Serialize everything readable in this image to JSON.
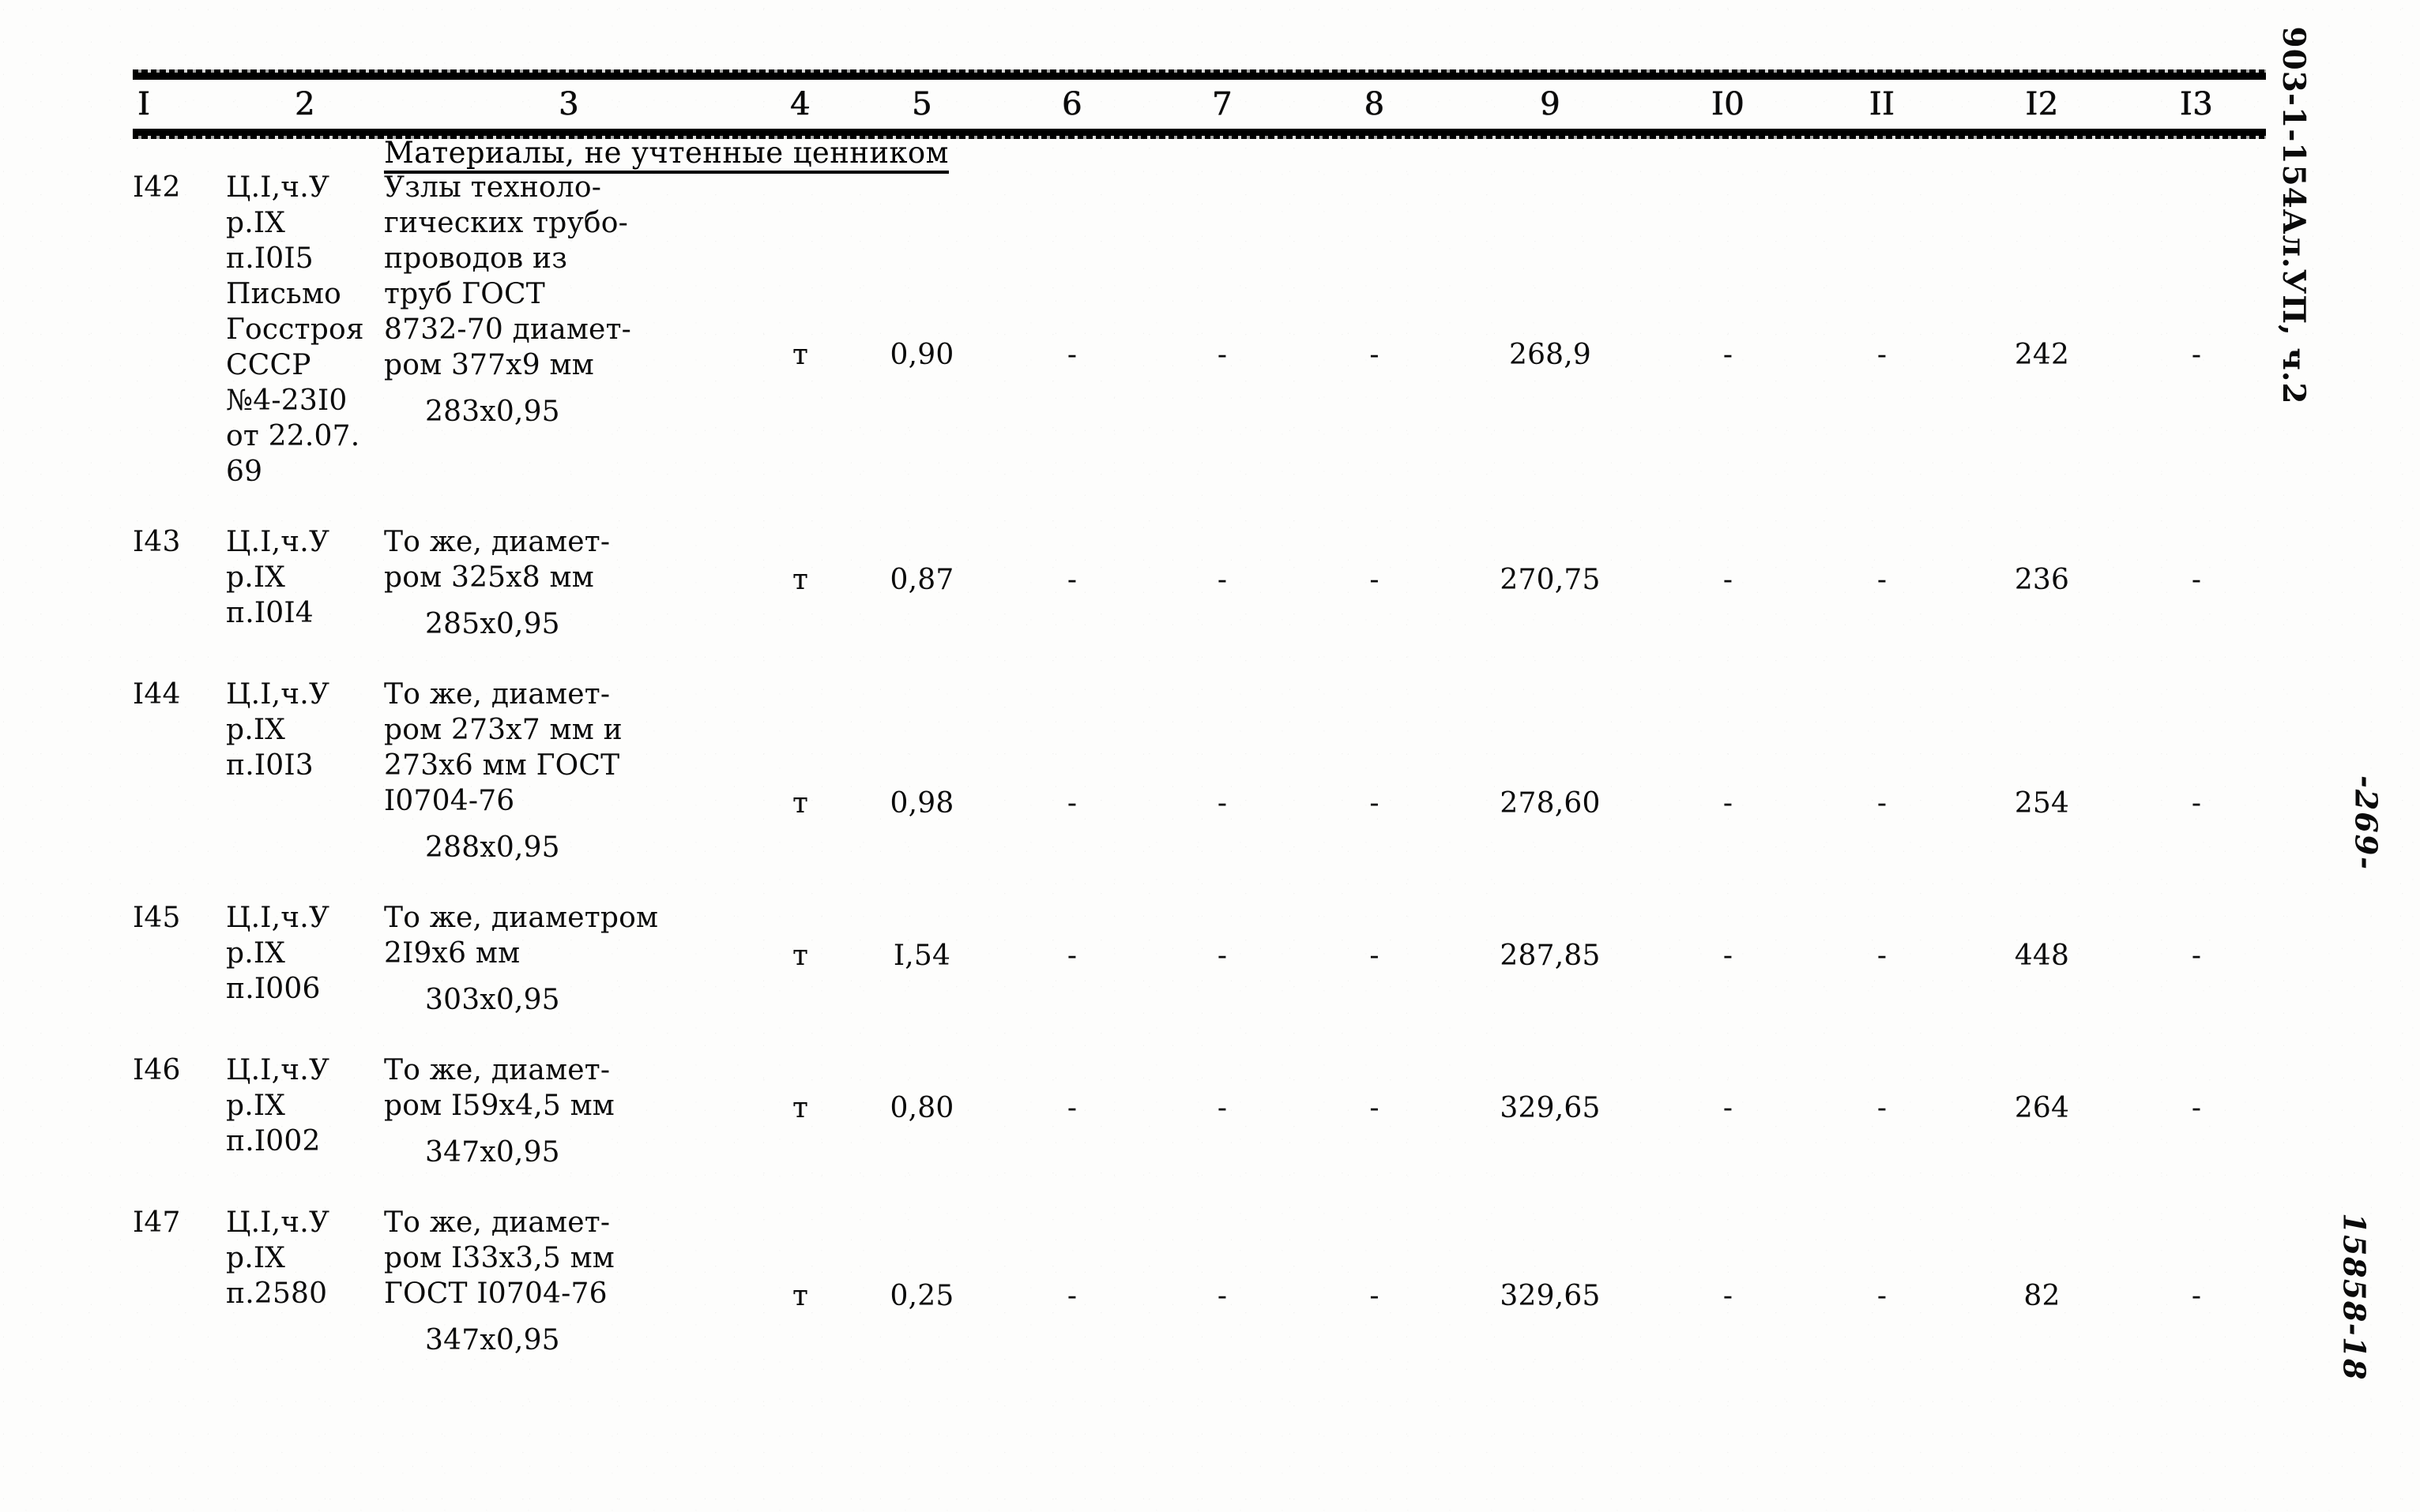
{
  "document": {
    "code_stamp": "903-1-154Ал.УП, ч.2",
    "page_number": "-269-",
    "archive_number": "15858-18"
  },
  "table": {
    "column_headers": [
      "I",
      "2",
      "3",
      "4",
      "5",
      "6",
      "7",
      "8",
      "9",
      "I0",
      "II",
      "I2",
      "I3"
    ],
    "section_title": "Материалы, не учтенные ценником",
    "rows": [
      {
        "id": "I42",
        "justification": "Ц.I,ч.У\nр.IX\nп.I0I5\nПисьмо\nГосстроя\nСССР\n№4-23I0\nот 22.07.\n69",
        "description": "Узлы техноло-\nгических трубо-\nпроводов из\nтруб ГОСТ\n8732-70 диамет-\nром 377х9 мм",
        "description_sub": "283х0,95",
        "unit": "т",
        "qty": "0,90",
        "c6": "-",
        "c7": "-",
        "c8": "-",
        "c9": "268,9",
        "c10": "-",
        "c11": "-",
        "c12": "242",
        "c13": "-"
      },
      {
        "id": "I43",
        "justification": "Ц.I,ч.У\nр.IX\nп.I0I4",
        "description": "То же, диамет-\nром 325х8 мм",
        "description_sub": "285х0,95",
        "unit": "т",
        "qty": "0,87",
        "c6": "-",
        "c7": "-",
        "c8": "-",
        "c9": "270,75",
        "c10": "-",
        "c11": "-",
        "c12": "236",
        "c13": "-"
      },
      {
        "id": "I44",
        "justification": "Ц.I,ч.У\nр.IX\nп.I0I3",
        "description": "То же, диамет-\nром 273х7 мм и\n273х6 мм ГОСТ\nI0704-76",
        "description_sub": "288х0,95",
        "unit": "т",
        "qty": "0,98",
        "c6": "-",
        "c7": "-",
        "c8": "-",
        "c9": "278,60",
        "c10": "-",
        "c11": "-",
        "c12": "254",
        "c13": "-"
      },
      {
        "id": "I45",
        "justification": "Ц.I,ч.У\nр.IX\nп.I006",
        "description": "То же, диаметром\n2I9х6 мм",
        "description_sub": "303х0,95",
        "unit": "т",
        "qty": "I,54",
        "c6": "-",
        "c7": "-",
        "c8": "-",
        "c9": "287,85",
        "c10": "-",
        "c11": "-",
        "c12": "448",
        "c13": "-"
      },
      {
        "id": "I46",
        "justification": "Ц.I,ч.У\nр.IX\nп.I002",
        "description": "То же, диамет-\nром I59х4,5 мм",
        "description_sub": "347х0,95",
        "unit": "т",
        "qty": "0,80",
        "c6": "-",
        "c7": "-",
        "c8": "-",
        "c9": "329,65",
        "c10": "-",
        "c11": "-",
        "c12": "264",
        "c13": "-"
      },
      {
        "id": "I47",
        "justification": "Ц.I,ч.У\nр.IX\nп.2580",
        "description": "То же, диамет-\nром I33х3,5 мм\nГОСТ I0704-76",
        "description_sub": "347х0,95",
        "unit": "т",
        "qty": "0,25",
        "c6": "-",
        "c7": "-",
        "c8": "-",
        "c9": "329,65",
        "c10": "-",
        "c11": "-",
        "c12": "82",
        "c13": "-"
      }
    ]
  }
}
